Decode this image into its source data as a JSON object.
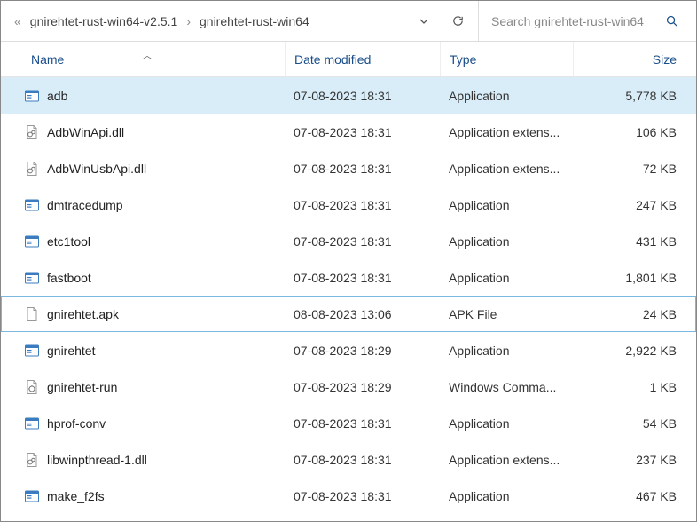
{
  "breadcrumb": {
    "prefix": "«",
    "part1": "gnirehtet-rust-win64-v2.5.1",
    "sep": "›",
    "part2": "gnirehtet-rust-win64"
  },
  "search": {
    "placeholder": "Search gnirehtet-rust-win64"
  },
  "columns": {
    "name": "Name",
    "date": "Date modified",
    "type": "Type",
    "size": "Size"
  },
  "files": [
    {
      "icon": "exe",
      "name": "adb",
      "date": "07-08-2023 18:31",
      "type": "Application",
      "size": "5,778 KB",
      "state": "selected"
    },
    {
      "icon": "dll",
      "name": "AdbWinApi.dll",
      "date": "07-08-2023 18:31",
      "type": "Application extens...",
      "size": "106 KB"
    },
    {
      "icon": "dll",
      "name": "AdbWinUsbApi.dll",
      "date": "07-08-2023 18:31",
      "type": "Application extens...",
      "size": "72 KB"
    },
    {
      "icon": "exe",
      "name": "dmtracedump",
      "date": "07-08-2023 18:31",
      "type": "Application",
      "size": "247 KB"
    },
    {
      "icon": "exe",
      "name": "etc1tool",
      "date": "07-08-2023 18:31",
      "type": "Application",
      "size": "431 KB"
    },
    {
      "icon": "exe",
      "name": "fastboot",
      "date": "07-08-2023 18:31",
      "type": "Application",
      "size": "1,801 KB"
    },
    {
      "icon": "file",
      "name": "gnirehtet.apk",
      "date": "08-08-2023 13:06",
      "type": "APK File",
      "size": "24 KB",
      "state": "focused"
    },
    {
      "icon": "exe",
      "name": "gnirehtet",
      "date": "07-08-2023 18:29",
      "type": "Application",
      "size": "2,922 KB"
    },
    {
      "icon": "cmd",
      "name": "gnirehtet-run",
      "date": "07-08-2023 18:29",
      "type": "Windows Comma...",
      "size": "1 KB"
    },
    {
      "icon": "exe",
      "name": "hprof-conv",
      "date": "07-08-2023 18:31",
      "type": "Application",
      "size": "54 KB"
    },
    {
      "icon": "dll",
      "name": "libwinpthread-1.dll",
      "date": "07-08-2023 18:31",
      "type": "Application extens...",
      "size": "237 KB"
    },
    {
      "icon": "exe",
      "name": "make_f2fs",
      "date": "07-08-2023 18:31",
      "type": "Application",
      "size": "467 KB"
    }
  ]
}
